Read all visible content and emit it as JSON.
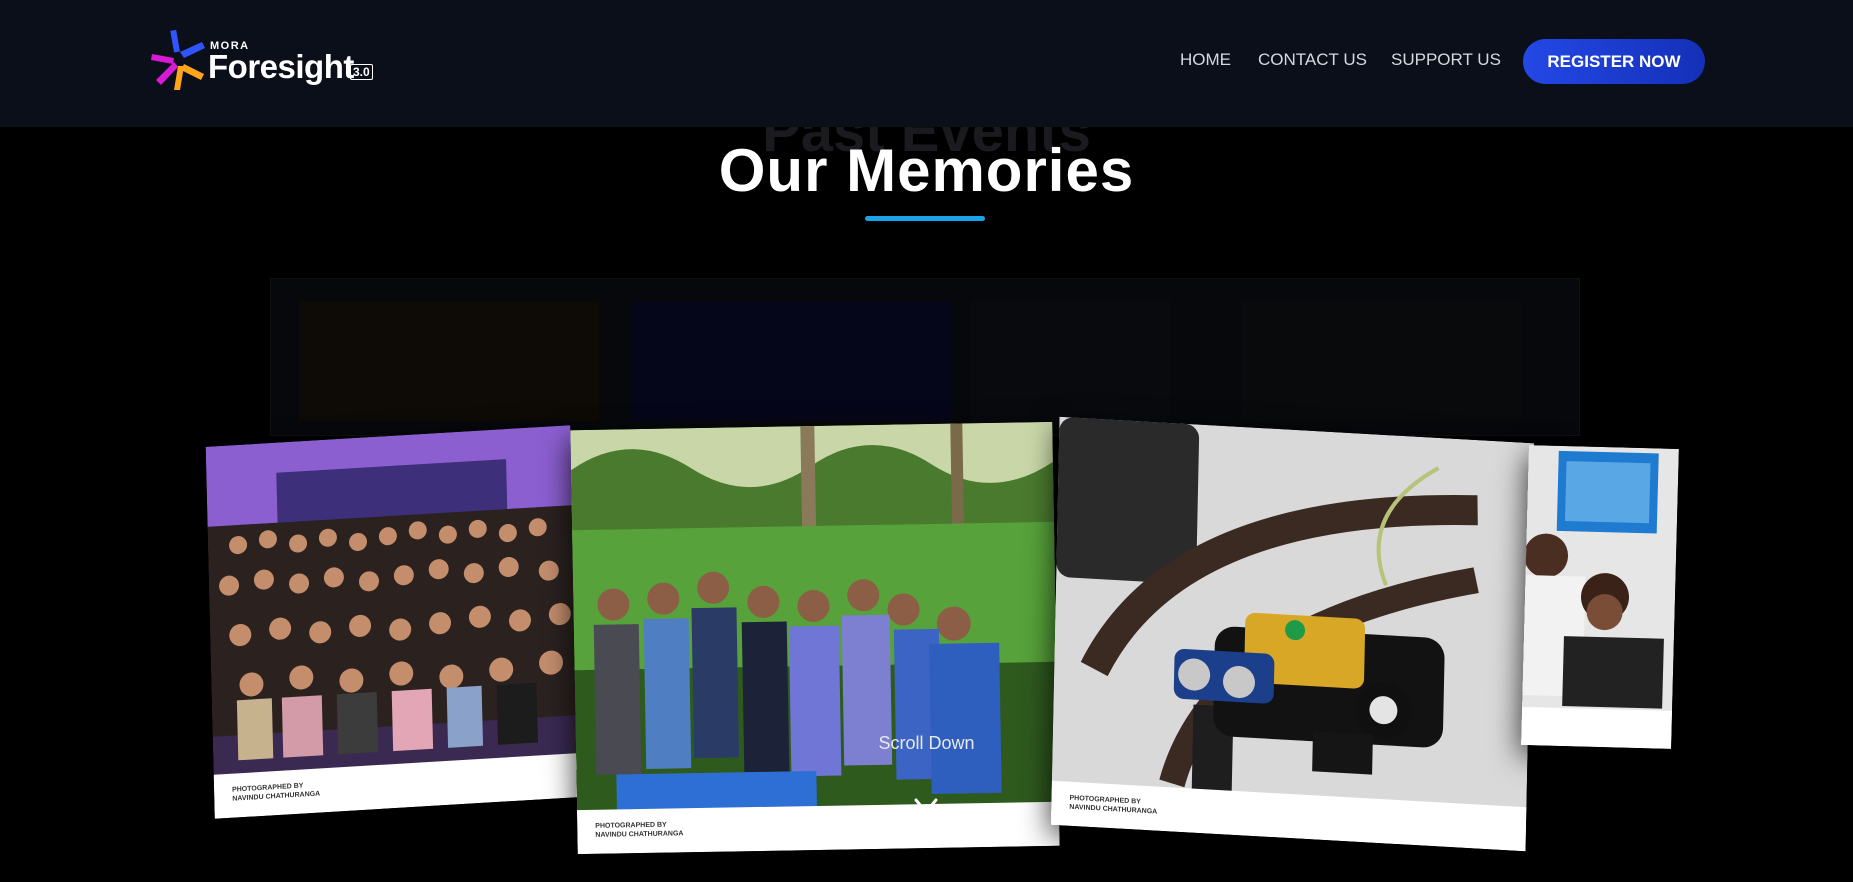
{
  "header": {
    "logo": {
      "small": "MORA",
      "name": "Foresight",
      "version": "3.0"
    },
    "nav": {
      "home": "HOME",
      "contact": "CONTACT US",
      "support": "SUPPORT US"
    },
    "cta": "REGISTER NOW"
  },
  "section": {
    "ghost_title": "Past Events",
    "title": "Our Memories",
    "scroll_label": "Scroll Down"
  },
  "photos": [
    {
      "credit_line1": "PHOTOGRAPHED BY",
      "credit_line2": "NAVINDU CHATHURANGA"
    },
    {
      "credit_line1": "PHOTOGRAPHED BY",
      "credit_line2": "NAVINDU CHATHURANGA"
    },
    {
      "credit_line1": "PHOTOGRAPHED BY",
      "credit_line2": "NAVINDU CHATHURANGA"
    }
  ],
  "colors": {
    "header_bg": "#0b0f1a",
    "accent": "#1aa3e6",
    "cta": "#2448e6",
    "page_bg": "#000000"
  }
}
